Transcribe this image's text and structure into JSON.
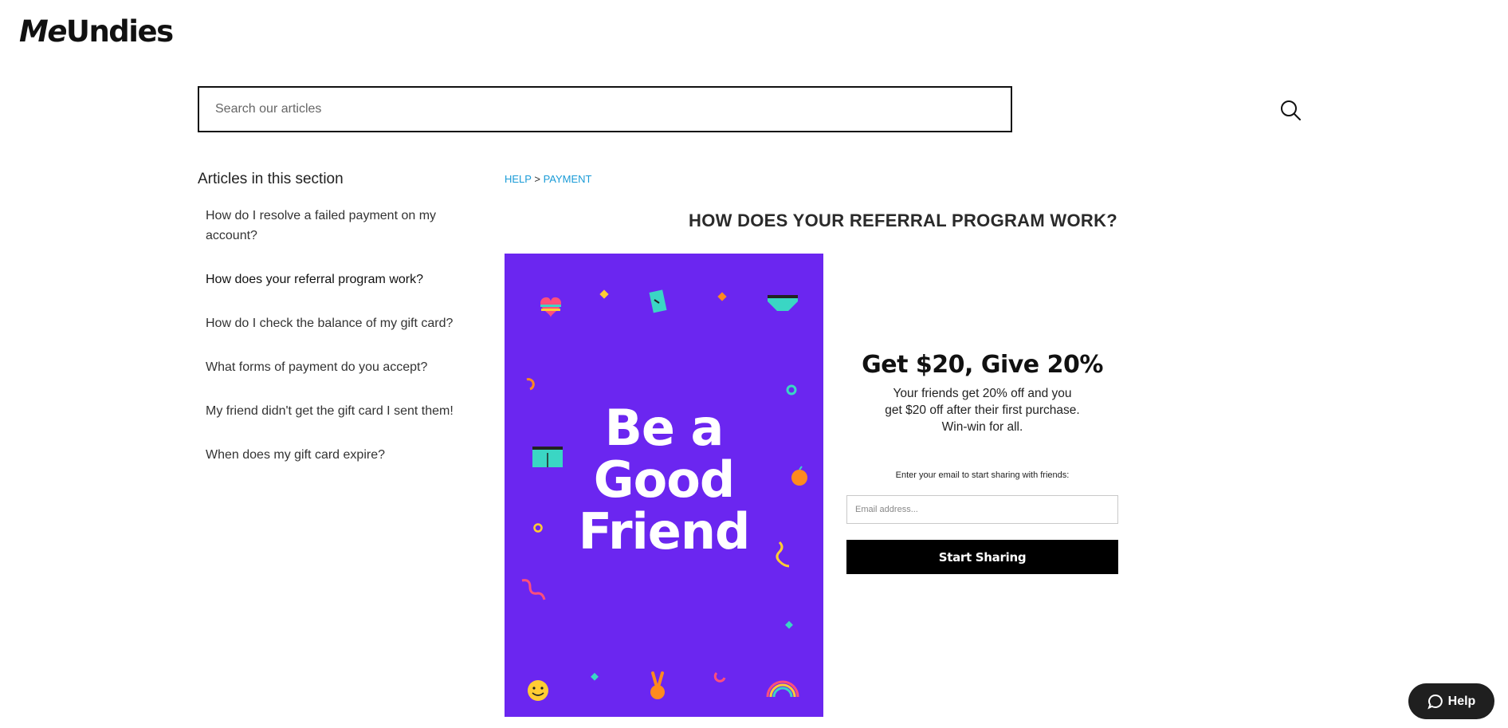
{
  "header": {
    "logo_me": "Me",
    "logo_undies": "Undies"
  },
  "search": {
    "placeholder": "Search our articles",
    "icon": "search-icon"
  },
  "sidebar": {
    "title": "Articles in this section",
    "items": [
      {
        "label": "How do I resolve a failed payment on my account?"
      },
      {
        "label": "How does your referral program work?"
      },
      {
        "label": "How do I check the balance of my gift card?"
      },
      {
        "label": "What forms of payment do you accept?"
      },
      {
        "label": "My friend didn't get the gift card I sent them!"
      },
      {
        "label": "When does my gift card expire?"
      }
    ]
  },
  "breadcrumb": {
    "home": "HELP",
    "separator": ">",
    "section": "PAYMENT"
  },
  "article": {
    "title": "HOW DOES YOUR REFERRAL PROGRAM WORK?"
  },
  "promo": {
    "line1": "Be a",
    "line2": "Good",
    "line3": "Friend",
    "background_color": "#6b26f0"
  },
  "offer": {
    "heading": "Get $20, Give 20%",
    "description": "Your friends get 20% off and you get $20 off after their first purchase. Win-win for all.",
    "email_prompt": "Enter your email to start sharing with friends:",
    "email_placeholder": "Email address...",
    "button_label": "Start Sharing"
  },
  "help_widget": {
    "label": "Help",
    "icon": "chat-bubble-icon"
  },
  "colors": {
    "link": "#1a9bd7",
    "button": "#000000",
    "help_bg": "#1f1f1f"
  }
}
